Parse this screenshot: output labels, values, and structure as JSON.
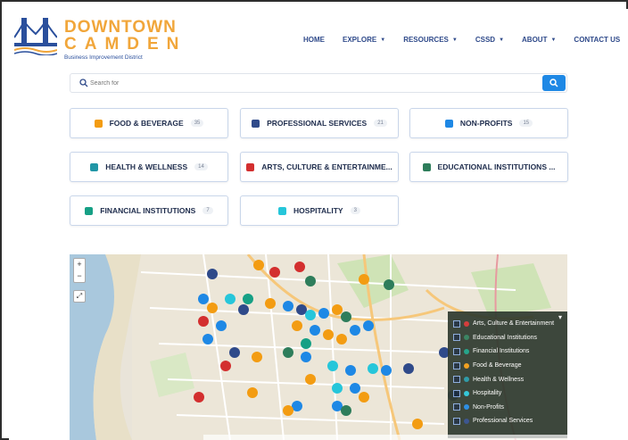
{
  "logo": {
    "line1": "DOWNTOWN",
    "line2": "CAMDEN",
    "line3": "Business Improvement District"
  },
  "nav": {
    "items": [
      {
        "label": "HOME",
        "dropdown": false
      },
      {
        "label": "EXPLORE",
        "dropdown": true
      },
      {
        "label": "RESOURCES",
        "dropdown": true
      },
      {
        "label": "CSSD",
        "dropdown": true
      },
      {
        "label": "ABOUT",
        "dropdown": true
      },
      {
        "label": "CONTACT US",
        "dropdown": false
      }
    ]
  },
  "search": {
    "placeholder": "Search for"
  },
  "categories": [
    {
      "label": "FOOD & BEVERAGE",
      "count": "35",
      "icon": "utensils-icon",
      "color": "#f39c12"
    },
    {
      "label": "PROFESSIONAL SERVICES",
      "count": "21",
      "icon": "people-icon",
      "color": "#2f4a8a"
    },
    {
      "label": "NON-PROFITS",
      "count": "15",
      "icon": "handshake-icon",
      "color": "#1e88e5"
    },
    {
      "label": "HEALTH & WELLNESS",
      "count": "14",
      "icon": "heart-icon",
      "color": "#2196a6"
    },
    {
      "label": "ARTS, CULTURE & ENTERTAINME...",
      "count": "",
      "icon": "masks-icon",
      "color": "#d32f2f"
    },
    {
      "label": "EDUCATIONAL INSTITUTIONS ...",
      "count": "",
      "icon": "school-icon",
      "color": "#2e7d5b"
    },
    {
      "label": "FINANCIAL INSTITUTIONS",
      "count": "7",
      "icon": "bank-icon",
      "color": "#16a085"
    },
    {
      "label": "HOSPITALITY",
      "count": "3",
      "icon": "hotel-icon",
      "color": "#26c6da"
    }
  ],
  "legend": {
    "items": [
      {
        "label": "Arts, Culture & Entertainment",
        "color": "#d32f2f"
      },
      {
        "label": "Educational Institutions",
        "color": "#2e7d5b"
      },
      {
        "label": "Financial Institutions",
        "color": "#16a085"
      },
      {
        "label": "Food & Beverage",
        "color": "#f39c12"
      },
      {
        "label": "Health & Wellness",
        "color": "#2196a6"
      },
      {
        "label": "Hospitality",
        "color": "#26c6da"
      },
      {
        "label": "Non-Profits",
        "color": "#1e88e5"
      },
      {
        "label": "Professional Services",
        "color": "#2f4a8a"
      }
    ]
  },
  "colors": {
    "accent": "#1e88e5",
    "logo_orange": "#f1a63a",
    "nav_blue": "#2f4a8a"
  }
}
